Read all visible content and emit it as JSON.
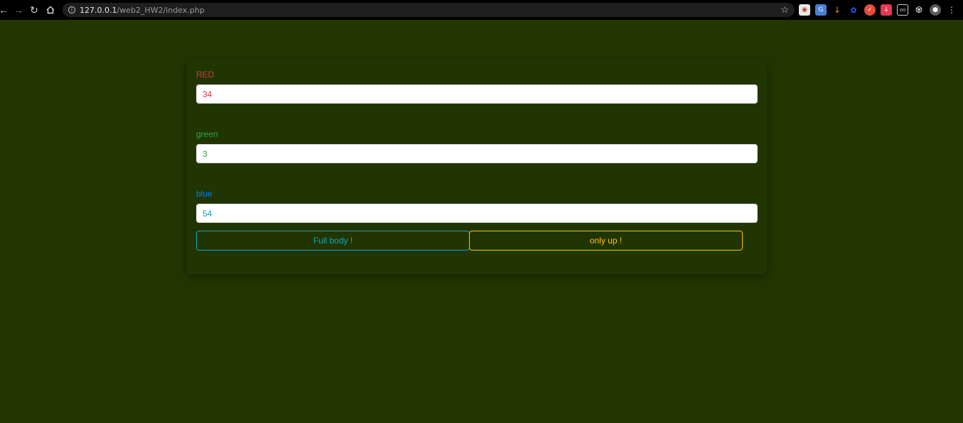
{
  "browser": {
    "url_host": "127.0.0.1",
    "url_path": "/web2_HW2/index.php",
    "icons": {
      "back": "arrow-left-icon",
      "forward": "arrow-right-icon",
      "reload": "reload-icon",
      "home": "home-icon",
      "info": "info-icon",
      "bookmark": "star-icon",
      "extensions": "puzzle-icon",
      "menu": "kebab-menu-icon"
    }
  },
  "form": {
    "red": {
      "label": "RED",
      "value": "34",
      "color": "#dc3545"
    },
    "green": {
      "label": "green",
      "value": "3",
      "color": "#28a745"
    },
    "blue": {
      "label": "blue",
      "value": "54",
      "color": "#17a2b8",
      "label_color": "#007bff"
    }
  },
  "buttons": {
    "full_body": {
      "label": "Full body !",
      "color": "#17a2b8"
    },
    "only_up": {
      "label": "only up !",
      "color": "#ffc107"
    }
  },
  "colors": {
    "page_background": "#223602",
    "card_background": "#213503"
  }
}
